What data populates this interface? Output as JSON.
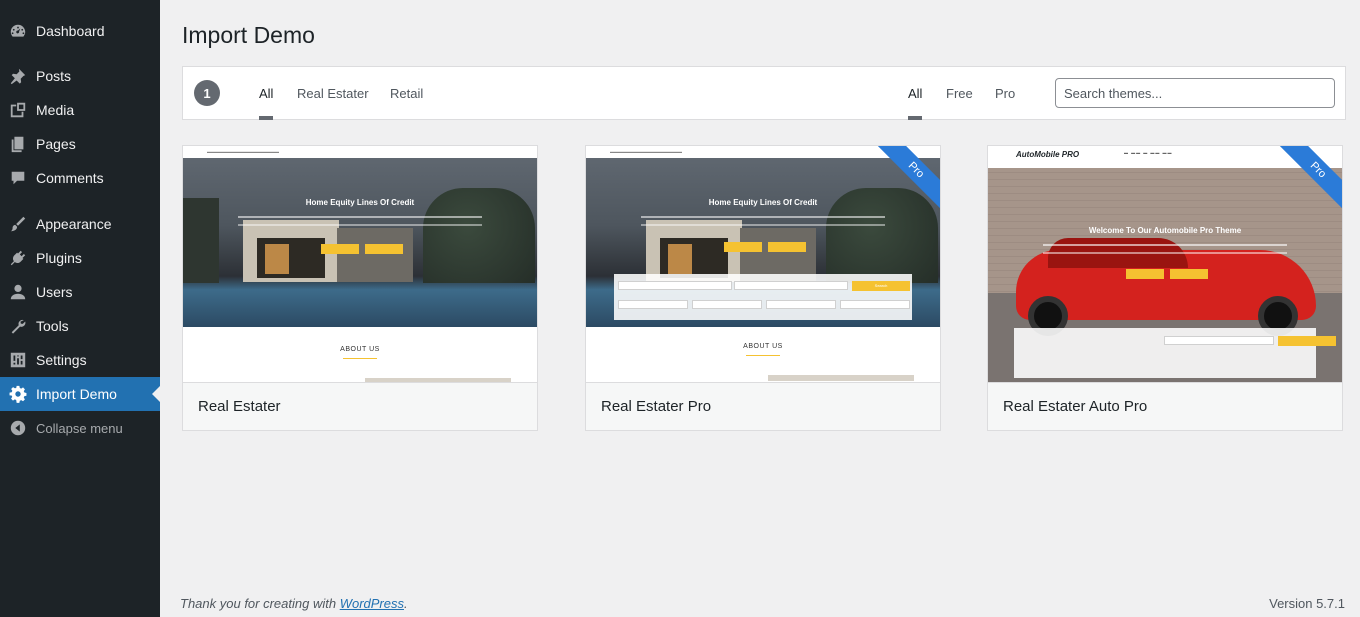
{
  "sidebar": {
    "items": [
      {
        "label": "Dashboard",
        "icon": "dashboard-icon"
      },
      {
        "label": "Posts",
        "icon": "pin-icon"
      },
      {
        "label": "Media",
        "icon": "media-icon"
      },
      {
        "label": "Pages",
        "icon": "pages-icon"
      },
      {
        "label": "Comments",
        "icon": "comment-icon"
      },
      {
        "label": "Appearance",
        "icon": "brush-icon"
      },
      {
        "label": "Plugins",
        "icon": "plug-icon"
      },
      {
        "label": "Users",
        "icon": "user-icon"
      },
      {
        "label": "Tools",
        "icon": "wrench-icon"
      },
      {
        "label": "Settings",
        "icon": "sliders-icon"
      },
      {
        "label": "Import Demo",
        "icon": "gear-icon",
        "current": true
      }
    ],
    "collapse_label": "Collapse menu"
  },
  "page": {
    "title": "Import Demo"
  },
  "filter_bar": {
    "count": "1",
    "category_tabs": [
      "All",
      "Real Estater",
      "Retail"
    ],
    "type_tabs": [
      "All",
      "Free",
      "Pro"
    ],
    "search_placeholder": "Search themes..."
  },
  "themes": [
    {
      "name": "Real Estater",
      "pro": false,
      "ribbon": "",
      "preview": {
        "hero_title": "Home Equity Lines Of Credit",
        "about_label": "ABOUT US"
      }
    },
    {
      "name": "Real Estater Pro",
      "pro": true,
      "ribbon": "Pro",
      "preview": {
        "hero_title": "Home Equity Lines Of Credit",
        "about_label": "ABOUT US",
        "search_button": "Search"
      }
    },
    {
      "name": "Real Estater Auto Pro",
      "pro": true,
      "ribbon": "Pro",
      "preview": {
        "logo_text": "AutoMobile PRO",
        "hero_title": "Welcome To Our Automobile Pro Theme"
      }
    }
  ],
  "footer": {
    "thanks_prefix": "Thank you for creating with ",
    "thanks_link": "WordPress",
    "thanks_suffix": ".",
    "version": "Version 5.7.1"
  },
  "colors": {
    "sidebar_bg": "#1d2327",
    "accent": "#2271b1",
    "ribbon": "#2b7bd8",
    "hero_button": "#f5c231"
  }
}
